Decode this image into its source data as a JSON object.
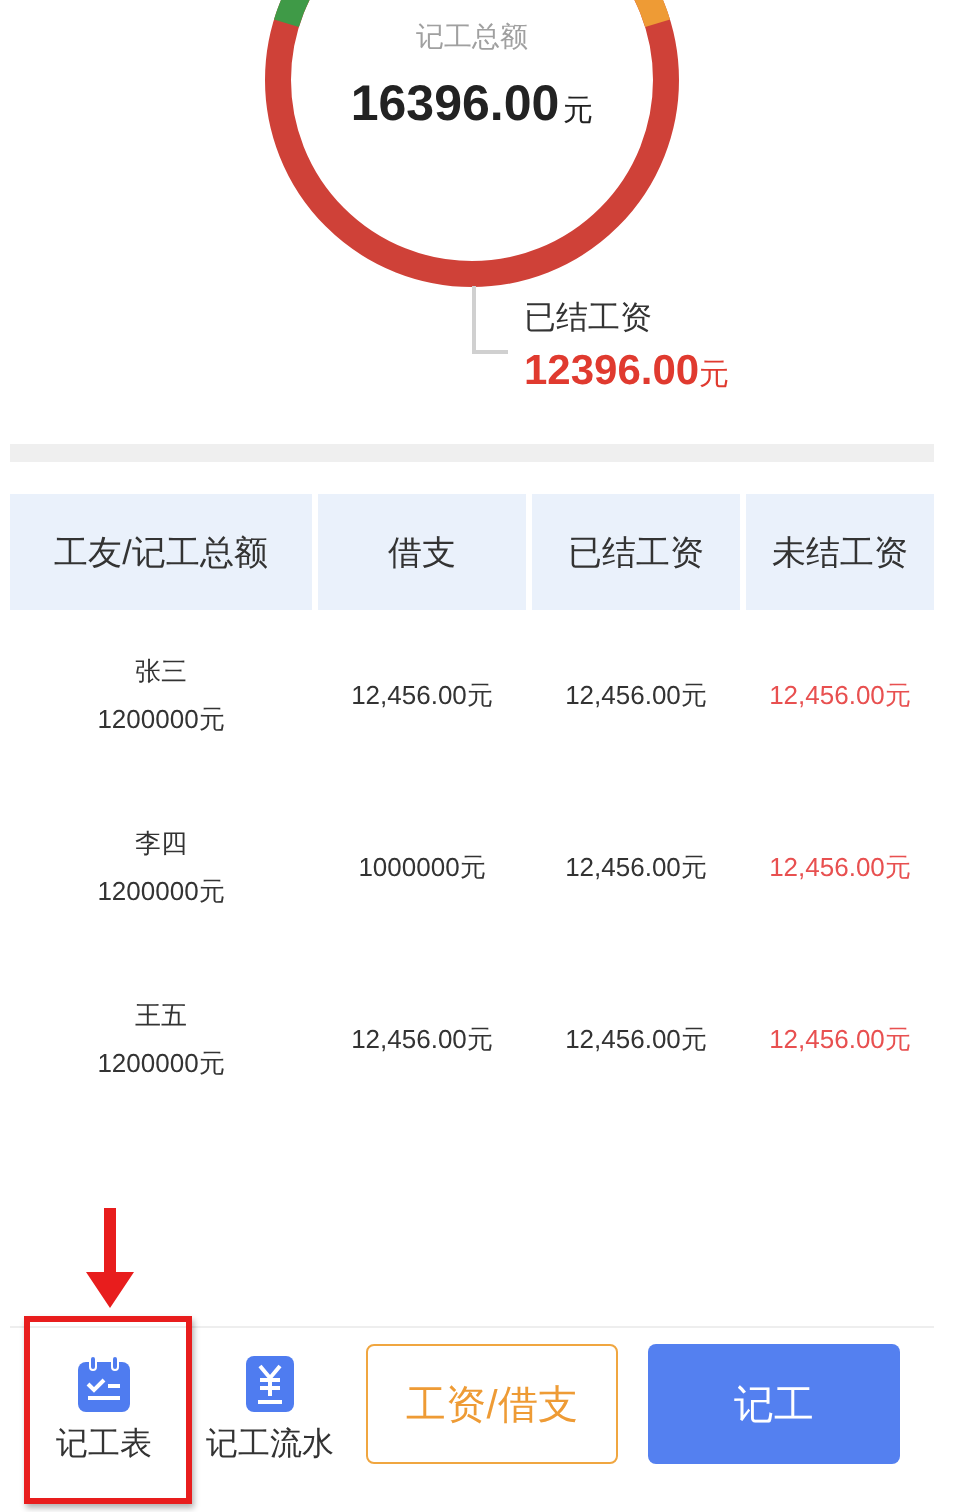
{
  "summary": {
    "label": "记工总额",
    "amount": "16396.00",
    "unit": "元"
  },
  "legend": {
    "label": "已结工资",
    "amount": "12396.00",
    "unit": "元"
  },
  "table": {
    "columns": [
      "工友/记工总额",
      "借支",
      "已结工资",
      "未结工资"
    ],
    "rows": [
      {
        "name": "张三",
        "total": "1200000元",
        "borrowed": "12,456.00元",
        "settled": "12,456.00元",
        "unsettled": "12,456.00元"
      },
      {
        "name": "李四",
        "total": "1200000元",
        "borrowed": "1000000元",
        "settled": "12,456.00元",
        "unsettled": "12,456.00元"
      },
      {
        "name": "王五",
        "total": "1200000元",
        "borrowed": "12,456.00元",
        "settled": "12,456.00元",
        "unsettled": "12,456.00元"
      }
    ]
  },
  "bottom_bar": [
    {
      "kind": "schedule",
      "label": "记工表",
      "highlighted": true
    },
    {
      "kind": "ledger",
      "label": "记工流水",
      "highlighted": false
    },
    {
      "kind": "outline",
      "label": "工资/借支",
      "highlighted": false
    },
    {
      "kind": "primary",
      "label": "记工",
      "highlighted": false
    }
  ]
}
